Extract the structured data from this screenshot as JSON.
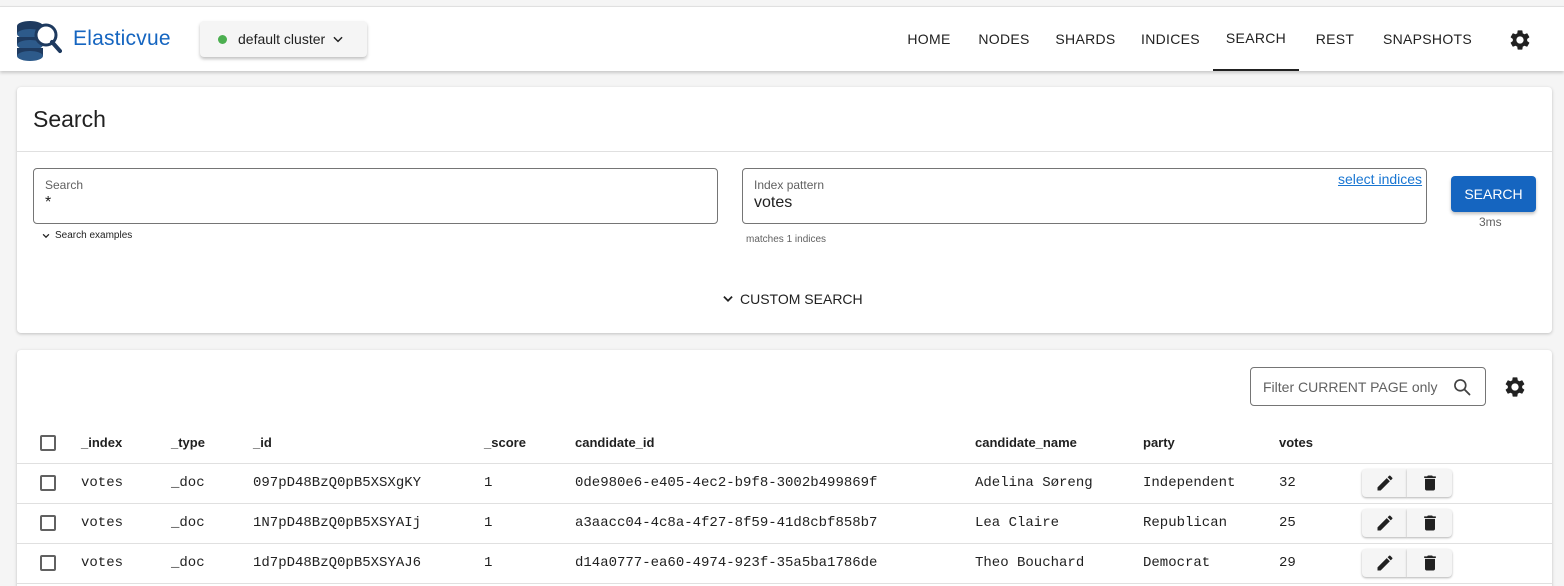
{
  "app": {
    "brand": "Elasticvue"
  },
  "cluster": {
    "label": "default cluster",
    "status_color": "#4caf50"
  },
  "nav": {
    "items": [
      "HOME",
      "NODES",
      "SHARDS",
      "INDICES",
      "SEARCH",
      "REST",
      "SNAPSHOTS"
    ],
    "active": "SEARCH"
  },
  "search_card": {
    "title": "Search",
    "search_field": {
      "label": "Search",
      "value": "*"
    },
    "search_examples": "Search examples",
    "index_field": {
      "label": "Index pattern",
      "value": "votes"
    },
    "select_indices": "select indices",
    "matches": "matches 1 indices",
    "search_button": "SEARCH",
    "timing": "3ms",
    "custom_search": "CUSTOM SEARCH"
  },
  "results": {
    "filter_placeholder": "Filter CURRENT PAGE only",
    "columns": [
      "_index",
      "_type",
      "_id",
      "_score",
      "candidate_id",
      "candidate_name",
      "party",
      "votes"
    ],
    "rows": [
      [
        "votes",
        "_doc",
        "097pD48BzQ0pB5XSXgKY",
        "1",
        "0de980e6-e405-4ec2-b9f8-3002b499869f",
        "Adelina Søreng",
        "Independent",
        "32"
      ],
      [
        "votes",
        "_doc",
        "1N7pD48BzQ0pB5XSYAIj",
        "1",
        "a3aacc04-4c8a-4f27-8f59-41d8cbf858b7",
        "Lea Claire",
        "Republican",
        "25"
      ],
      [
        "votes",
        "_doc",
        "1d7pD48BzQ0pB5XSYAJ6",
        "1",
        "d14a0777-ea60-4974-923f-35a5ba1786de",
        "Theo Bouchard",
        "Democrat",
        "29"
      ]
    ]
  },
  "colors": {
    "accent": "#1565c0",
    "link": "#1976d2"
  }
}
